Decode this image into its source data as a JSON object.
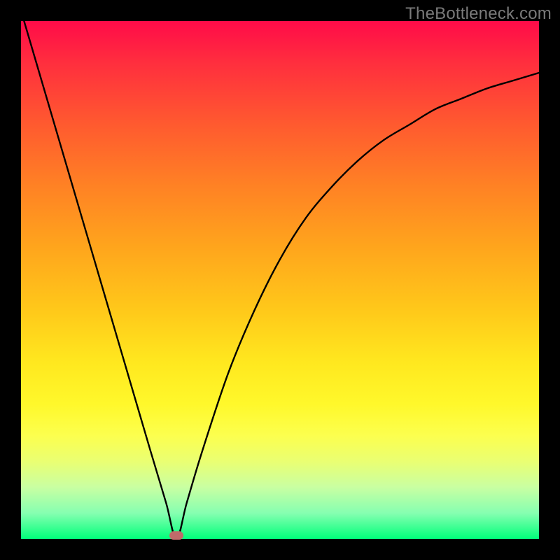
{
  "watermark": {
    "text": "TheBottleneck.com"
  },
  "chart_data": {
    "type": "line",
    "title": "",
    "xlabel": "",
    "ylabel": "",
    "xlim": [
      0,
      100
    ],
    "ylim": [
      0,
      100
    ],
    "grid": false,
    "legend": false,
    "series": [
      {
        "name": "curve",
        "x": [
          0,
          5,
          10,
          15,
          20,
          25,
          28,
          30,
          32,
          35,
          40,
          45,
          50,
          55,
          60,
          65,
          70,
          75,
          80,
          85,
          90,
          95,
          100
        ],
        "y": [
          102,
          85,
          68,
          51,
          34,
          17,
          7,
          0,
          7,
          17,
          32,
          44,
          54,
          62,
          68,
          73,
          77,
          80,
          83,
          85,
          87,
          88.5,
          90
        ]
      }
    ],
    "marker": {
      "x": 30,
      "y": 0.7,
      "color": "#c06a6a"
    },
    "background_gradient": {
      "top": "#ff0b49",
      "mid": "#ffd21a",
      "bottom": "#00ff7a"
    }
  }
}
